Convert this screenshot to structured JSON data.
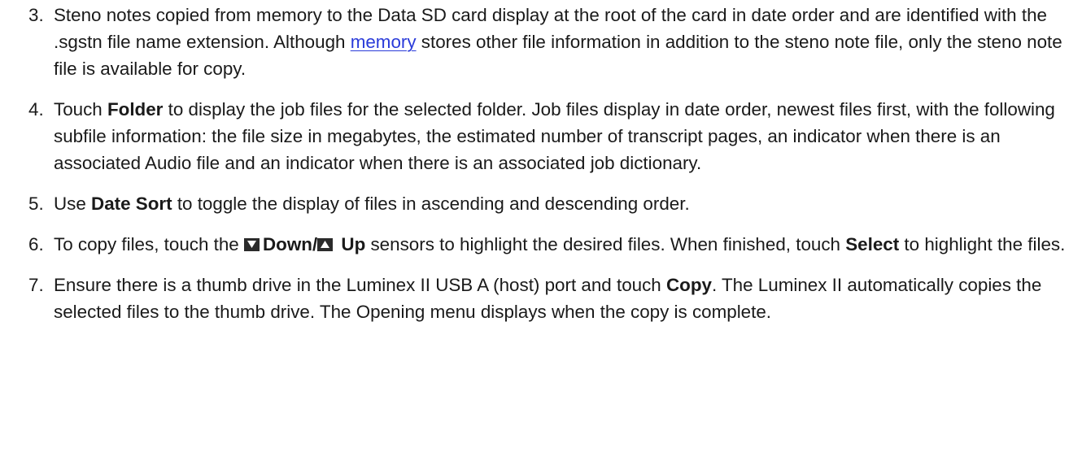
{
  "steps": [
    {
      "num": "3.",
      "t1": "Steno notes copied from memory to the Data SD card display at the root of the card in date order and are identified with the .sgstn file name extension. Although ",
      "link": "memory",
      "t2": " stores other file information in addition to the steno note file, only the steno note file is available for copy."
    },
    {
      "num": "4.",
      "t1": "Touch ",
      "b1": "Folder",
      "t2": " to display the job files for the selected folder. Job files display in date order, newest files first, with the following subfile information: the file size in megabytes, the estimated number of transcript pages, an indicator when there is an associated Audio file and an indicator when there is an associated job dictionary."
    },
    {
      "num": "5.",
      "t1": "Use ",
      "b1": "Date Sort",
      "t2": " to toggle the display of files in ascending and descending order."
    },
    {
      "num": "6.",
      "t1": "To copy files, touch the ",
      "icon_down": "down-sensor-icon",
      "b1": "Down/",
      "icon_up": "up-sensor-icon",
      "b2": "Up",
      "t2": " sensors to highlight the desired files. When finished, touch ",
      "b3": "Select",
      "t3": " to highlight the files."
    },
    {
      "num": "7.",
      "t1": "Ensure there is a thumb drive in the Luminex II USB A (host) port and touch ",
      "b1": "Copy",
      "t2": ". The Luminex II automatically copies the selected files to the thumb drive. The Opening menu displays when the copy is complete."
    }
  ],
  "colors": {
    "text": "#1a1a1a",
    "link": "#2a3bd9",
    "icon_bg": "#2b2b2b"
  }
}
